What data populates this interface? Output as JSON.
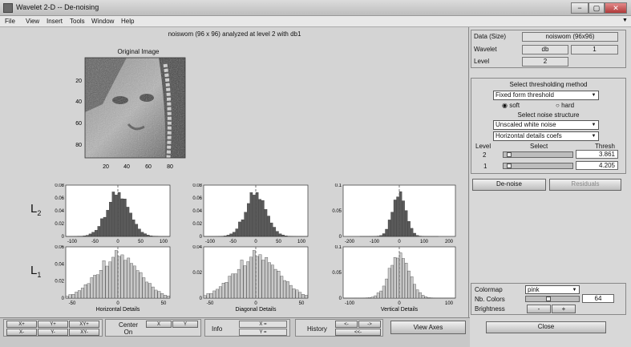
{
  "window": {
    "title": "Wavelet 2-D  --  De-noising",
    "min": "−",
    "max": "▢",
    "close": "✕"
  },
  "menu": [
    "File",
    "View",
    "Insert",
    "Tools",
    "Window",
    "Help"
  ],
  "plot_caption": "noiswom  (96 x 96)  analyzed at level 2  with db1",
  "original": {
    "title": "Original Image",
    "yticks": [
      "20",
      "40",
      "60",
      "80"
    ],
    "xticks": [
      "20",
      "40",
      "60",
      "80"
    ]
  },
  "level_labels": {
    "l2": "L",
    "l2sub": "2",
    "l1": "L",
    "l1sub": "1"
  },
  "hist": {
    "h2": {
      "yticks": [
        "0.08",
        "0.06",
        "0.04",
        "0.02",
        "0"
      ],
      "xticks": [
        "-100",
        "-50",
        "0",
        "50",
        "100"
      ]
    },
    "d2": {
      "yticks": [
        "0.08",
        "0.06",
        "0.04",
        "0.02",
        "0"
      ],
      "xticks": [
        "-100",
        "-50",
        "0",
        "50",
        "100"
      ]
    },
    "v2": {
      "yticks": [
        "0.1",
        "0.05",
        "0"
      ],
      "xticks": [
        "-200",
        "-100",
        "0",
        "100",
        "200"
      ]
    },
    "h1": {
      "yticks": [
        "0.06",
        "0.04",
        "0.02",
        "0"
      ],
      "xticks": [
        "-50",
        "0",
        "50"
      ],
      "xlabel": "Horizontal Details"
    },
    "d1": {
      "yticks": [
        "0.04",
        "0.02",
        "0"
      ],
      "xticks": [
        "-50",
        "0",
        "50"
      ],
      "xlabel": "Diagonal Details"
    },
    "v1": {
      "yticks": [
        "0.1",
        "0.05",
        "0"
      ],
      "xticks": [
        "-100",
        "0",
        "100"
      ],
      "xlabel": "Vertical Details"
    }
  },
  "info": {
    "data_label": "Data (Size)",
    "data_value": "noiswom (96x96)",
    "wavelet_label": "Wavelet",
    "wavelet_family": "db",
    "wavelet_order": "1",
    "level_label": "Level",
    "level_value": "2"
  },
  "thresh": {
    "title": "Select thresholding method",
    "method": "Fixed form threshold",
    "soft": "soft",
    "hard": "hard",
    "noise_title": "Select noise structure",
    "noise": "Unscaled white noise",
    "details": "Horizontal details coefs",
    "col_level": "Level",
    "col_select": "Select",
    "col_thresh": "Thresh",
    "rows": [
      {
        "level": "2",
        "value": "3.861",
        "pos": 0.05
      },
      {
        "level": "1",
        "value": "4.205",
        "pos": 0.05
      }
    ]
  },
  "denoise_label": "De-noise",
  "residuals_label": "Residuals",
  "colormap": {
    "label": "Colormap",
    "value": "pink",
    "ncolors_label": "Nb. Colors",
    "ncolors": "64",
    "brightness_label": "Brightness",
    "minus": "-",
    "plus": "+"
  },
  "close_label": "Close",
  "bottom": {
    "xp": "X+",
    "yp": "Y+",
    "xyp": "XY+",
    "xm": "X-",
    "ym": "Y-",
    "xym": "XY-",
    "center": "Center",
    "on": "On",
    "x": "X",
    "y": "Y",
    "info": "Info",
    "xeq": "X =",
    "yeq": "Y =",
    "history": "History",
    "hl": "<-",
    "hr": "->",
    "hll": "<<-",
    "viewaxes": "View Axes"
  }
}
